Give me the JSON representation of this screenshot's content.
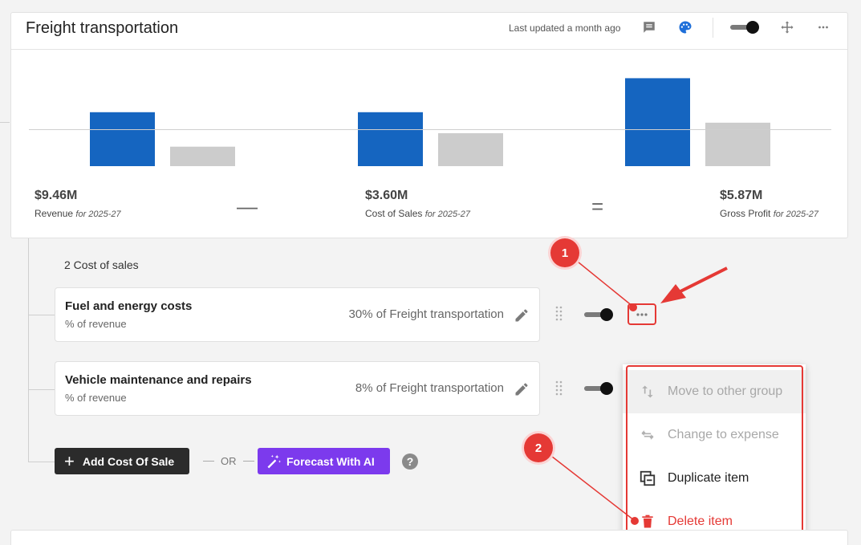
{
  "card": {
    "title": "Freight transportation",
    "last_updated": "Last updated a month ago",
    "icons": [
      "comment-icon",
      "palette-icon",
      "toggle",
      "move-icon",
      "more-icon"
    ]
  },
  "chart_data": {
    "type": "bar",
    "categories": [
      "Revenue",
      "Cost of Sales",
      "Gross Profit"
    ],
    "series": [
      {
        "values": [
          3.6,
          3.6,
          5.87
        ],
        "color": "#1565c0"
      },
      {
        "values": [
          1.3,
          2.2,
          2.9
        ],
        "color": "#cccccc"
      }
    ],
    "title": "",
    "xlabel": "",
    "ylabel": "",
    "ylim": [
      0,
      7.5
    ],
    "grid": false
  },
  "metrics": [
    {
      "value": "$9.46M",
      "label": "Revenue",
      "period": "for 2025-27"
    },
    {
      "value": "$3.60M",
      "label": "Cost of Sales",
      "period": "for 2025-27"
    },
    {
      "value": "$5.87M",
      "label": "Gross Profit",
      "period": "for 2025-27"
    }
  ],
  "operators": {
    "minus": "—",
    "equals": "="
  },
  "group": {
    "title": "2 Cost of sales"
  },
  "rows": [
    {
      "name": "Fuel and energy costs",
      "sub": "% of revenue",
      "pct": "30% of Freight transportation"
    },
    {
      "name": "Vehicle maintenance and repairs",
      "sub": "% of revenue",
      "pct": "8% of Freight transportation"
    }
  ],
  "actions": {
    "add": "Add Cost Of Sale",
    "or": "OR",
    "ai": "Forecast With AI",
    "help": "?"
  },
  "menu": {
    "items": [
      {
        "label": "Move to other group",
        "icon": "swap-vertical-icon",
        "state": "disabled"
      },
      {
        "label": "Change to expense",
        "icon": "swap-horizontal-icon",
        "state": "disabled"
      },
      {
        "label": "Duplicate item",
        "icon": "duplicate-icon",
        "state": "normal"
      },
      {
        "label": "Delete item",
        "icon": "trash-icon",
        "state": "danger"
      }
    ]
  },
  "annotations": {
    "badge1": "1",
    "badge2": "2"
  },
  "colors": {
    "accent_blue": "#1565c0",
    "bar_gray": "#cccccc",
    "danger": "#e53935",
    "ai_purple": "#7c3aed"
  }
}
